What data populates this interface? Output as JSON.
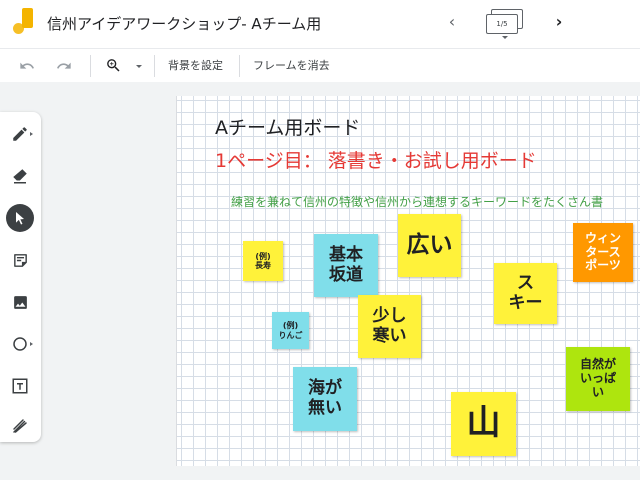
{
  "app": {
    "document_title": "信州アイデアワークショップ- Aチーム用",
    "frame_counter": "1/5",
    "prev_icon": "chevron-left-icon",
    "next_icon": "chevron-right-icon"
  },
  "toolbar": {
    "undo_icon": "undo-icon",
    "redo_icon": "redo-icon",
    "zoom_icon": "zoom-in-icon",
    "set_background_label": "背景を設定",
    "clear_frame_label": "フレームを消去"
  },
  "tools": [
    {
      "name": "pen-icon",
      "active": false
    },
    {
      "name": "eraser-icon",
      "active": false
    },
    {
      "name": "select-icon",
      "active": true
    },
    {
      "name": "sticky-note-icon",
      "active": false
    },
    {
      "name": "image-icon",
      "active": false
    },
    {
      "name": "circle-icon",
      "active": false
    },
    {
      "name": "text-box-icon",
      "active": false
    },
    {
      "name": "laser-icon",
      "active": false
    }
  ],
  "board": {
    "title": "Aチーム用ボード",
    "subtitle": "1ページ目：  落書き・お試し用ボード",
    "instruction": "練習を兼ねて信州の特徴や信州から連想するキーワードをたくさん書",
    "notes": [
      {
        "text": "(例)\n長寿",
        "color": "yellow"
      },
      {
        "text": "(例)\nりんご",
        "color": "cyan"
      },
      {
        "text": "基本\n坂道",
        "color": "cyan"
      },
      {
        "text": "広い",
        "color": "yellow"
      },
      {
        "text": "少し\n寒い",
        "color": "yellow"
      },
      {
        "text": "海が\n無い",
        "color": "cyan"
      },
      {
        "text": "ス\nキー",
        "color": "yellow"
      },
      {
        "text": "ウィン\nタース\nポーツ",
        "color": "orange"
      },
      {
        "text": "自然が\nいっぱ\nい",
        "color": "lime"
      },
      {
        "text": "山",
        "color": "yellow"
      }
    ]
  },
  "colors": {
    "accent": "#f4b400",
    "subtitle": "#e53935",
    "instruction": "#43a047",
    "note_yellow": "#fff23a",
    "note_cyan": "#80deea",
    "note_orange": "#ff9800",
    "note_lime": "#aee50e"
  }
}
